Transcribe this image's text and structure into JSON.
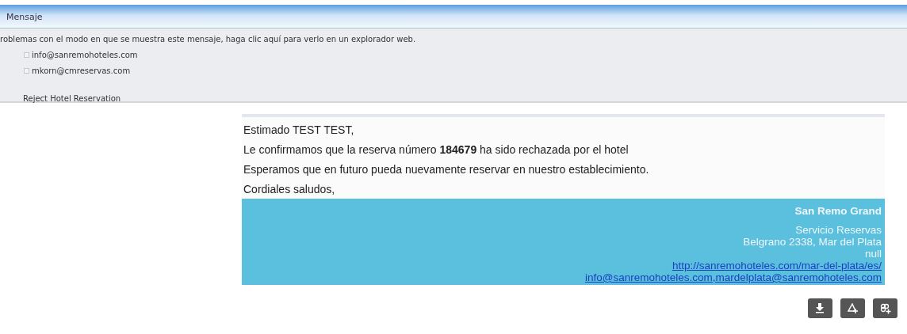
{
  "header": {
    "title": "Mensaje"
  },
  "info_bar": {
    "notice": "roblemas con el modo en que se muestra este mensaje, haga clic aquí para verlo en un explorador web.",
    "recipients": [
      "info@sanremohoteles.com",
      "mkorn@cmreservas.com"
    ],
    "subject": "Reject Hotel Reservation"
  },
  "email": {
    "paragraphs": [
      "Estimado TEST TEST,",
      "Le confirmamos que la reserva número **184679** ha sido rechazada por el hotel",
      "Esperamos que en futuro pueda nuevamente reservar en nuestro establecimiento.",
      "Cordiales saludos,"
    ],
    "signature": {
      "name": "San Remo Grand",
      "lines": [
        "Servicio Reservas",
        "Belgrano 2338, Mar del Plata",
        "null"
      ],
      "links": [
        "http://sanremohoteles.com/mar-del-plata/es/",
        "info@sanremohoteles.com,mardelplata@sanremohoteles.com"
      ]
    }
  },
  "actions": [
    {
      "kind": "download"
    },
    {
      "kind": "drive"
    },
    {
      "kind": "photos"
    }
  ]
}
